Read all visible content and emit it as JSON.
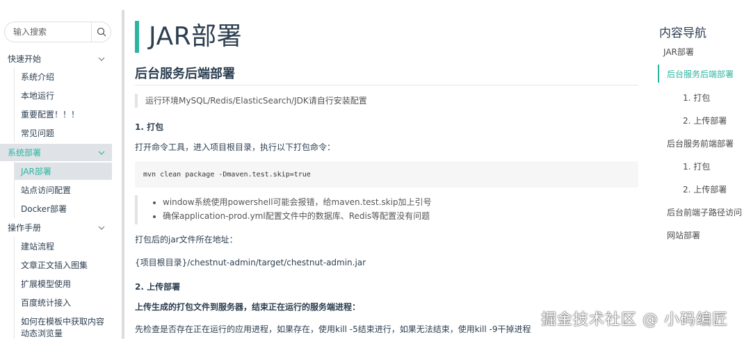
{
  "search": {
    "placeholder": "输入搜索"
  },
  "sidebar": {
    "groups": [
      {
        "label": "快速开始",
        "items": [
          "系统介绍",
          "本地运行",
          "重要配置！！！",
          "常见问题"
        ]
      },
      {
        "label": "系统部署",
        "items": [
          "JAR部署",
          "站点访问配置",
          "Docker部署"
        ]
      },
      {
        "label": "操作手册",
        "items": [
          "建站流程",
          "文章正文插入图集",
          "扩展模型使用",
          "百度统计接入",
          "如何在模板中获取内容动态浏览量"
        ]
      }
    ],
    "active_group": "系统部署",
    "active_item": "JAR部署"
  },
  "content": {
    "title": "JAR部署",
    "section_title": "后台服务后端部署",
    "quote": "运行环境MySQL/Redis/ElasticSearch/JDK请自行安装配置",
    "step1_title": "1. 打包",
    "step1_desc": "打开命令工具，进入项目根目录，执行以下打包命令：",
    "code": "mvn clean package -Dmaven.test.skip=true",
    "notes": [
      "window系统使用powershell可能会报错，给maven.test.skip加上引号",
      "确保application-prod.yml配置文件中的数据库、Redis等配置没有问题"
    ],
    "jar_location_label": "打包后的jar文件所在地址：",
    "jar_path": "{项目根目录}/chestnut-admin/target/chestnut-admin.jar",
    "step2_title": "2. 上传部署",
    "step2_bold": "上传生成的打包文件到服务器，结束正在运行的服务端进程：",
    "step2_desc": "先检查是否存在正在运行的应用进程，如果存在，使用kill -5结束进行，如果无法结束，使用kill -9干掉进程"
  },
  "toc": {
    "title": "内容导航",
    "items": [
      {
        "label": "JAR部署",
        "level": 1
      },
      {
        "label": "后台服务后端部署",
        "level": 2,
        "active": true
      },
      {
        "label": "1. 打包",
        "level": 3
      },
      {
        "label": "2. 上传部署",
        "level": 3
      },
      {
        "label": "后台服务前端部署",
        "level": 2
      },
      {
        "label": "1. 打包",
        "level": 3
      },
      {
        "label": "2. 上传部署",
        "level": 3
      },
      {
        "label": "后台前端子路径访问",
        "level": 2
      },
      {
        "label": "网站部署",
        "level": 2
      }
    ]
  },
  "watermark": "掘金技术社区 @ 小码编匠",
  "colors": {
    "accent": "#2bb5a0",
    "active_bg": "#dfe3e7",
    "text": "#2c3e50"
  },
  "icons": {
    "search": "search-icon",
    "chevron": "chevron-down-icon"
  }
}
